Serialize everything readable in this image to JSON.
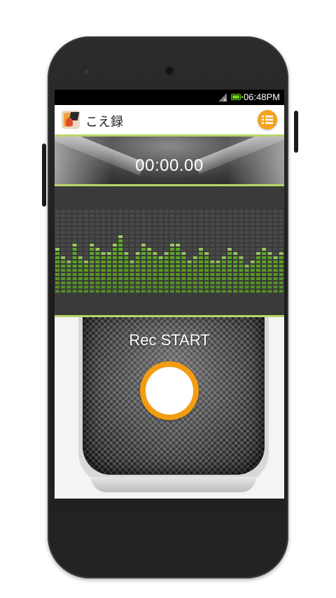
{
  "status_bar": {
    "time": "06:48PM",
    "signal_icon": "signal-no-data-icon",
    "battery_icon": "battery-charging-icon"
  },
  "action_bar": {
    "title": "こえ録",
    "logo_icon": "app-logo-icon",
    "menu_icon": "list-menu-icon",
    "accent_color": "#f5a31e",
    "divider_color": "#b9d66a"
  },
  "timer": {
    "value": "00:00.00"
  },
  "visualizer": {
    "bar_color": "#66cc1a",
    "levels": [
      0.55,
      0.45,
      0.4,
      0.62,
      0.45,
      0.4,
      0.6,
      0.55,
      0.5,
      0.48,
      0.58,
      0.68,
      0.48,
      0.42,
      0.52,
      0.62,
      0.55,
      0.5,
      0.45,
      0.52,
      0.6,
      0.58,
      0.48,
      0.4,
      0.45,
      0.55,
      0.5,
      0.42,
      0.38,
      0.46,
      0.55,
      0.5,
      0.45,
      0.35,
      0.42,
      0.5,
      0.55,
      0.48,
      0.44,
      0.52
    ]
  },
  "record": {
    "label": "Rec START",
    "button_color": "#f39c12"
  }
}
